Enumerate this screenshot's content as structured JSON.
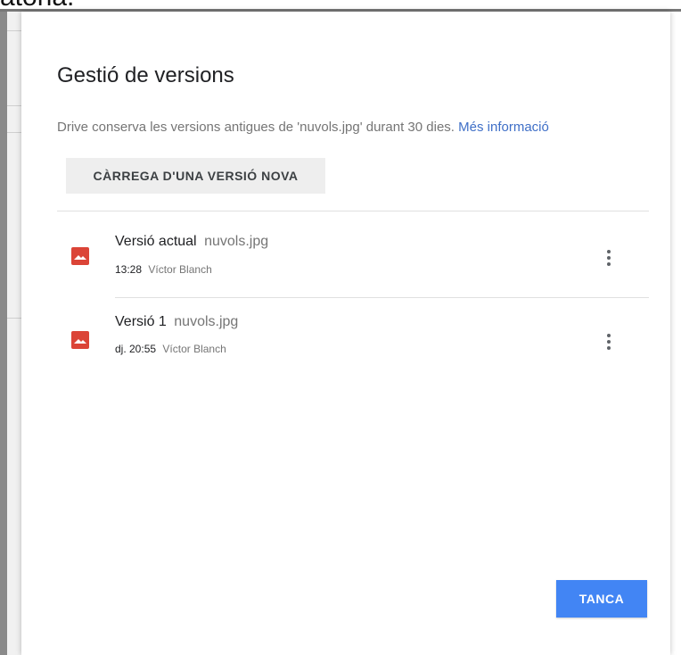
{
  "background": {
    "cropped_text": "atòria."
  },
  "dialog": {
    "title": "Gestió de versions",
    "description": "Drive conserva les versions antigues de 'nuvols.jpg' durant 30 dies.",
    "more_info_link": "Més informació",
    "upload_button": "CÀRREGA D'UNA VERSIÓ NOVA",
    "close_button": "TANCA",
    "versions": [
      {
        "label": "Versió actual",
        "file": "nuvols.jpg",
        "time": "13:28",
        "author": "Víctor Blanch",
        "icon": "image-file-icon"
      },
      {
        "label": "Versió 1",
        "file": "nuvols.jpg",
        "time": "dj. 20:55",
        "author": "Víctor Blanch",
        "icon": "image-file-icon"
      }
    ]
  },
  "colors": {
    "accent": "#4285f4",
    "link": "#3f6fc7",
    "file_icon": "#db4437",
    "button_bg": "#eeeeee"
  }
}
